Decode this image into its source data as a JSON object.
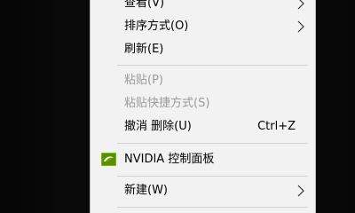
{
  "menu": {
    "items": [
      {
        "label": "查看(V)",
        "has_submenu": true,
        "disabled": false
      },
      {
        "label": "排序方式(O)",
        "has_submenu": true,
        "disabled": false
      },
      {
        "label": "刷新(E)",
        "has_submenu": false,
        "disabled": false
      },
      {
        "label": "粘贴(P)",
        "has_submenu": false,
        "disabled": true
      },
      {
        "label": "粘贴快捷方式(S)",
        "has_submenu": false,
        "disabled": true
      },
      {
        "label": "撤消 删除(U)",
        "shortcut": "Ctrl+Z",
        "has_submenu": false,
        "disabled": false
      },
      {
        "label": "NVIDIA 控制面板",
        "icon": "nvidia-icon",
        "has_submenu": false,
        "disabled": false
      },
      {
        "label": "新建(W)",
        "has_submenu": true,
        "disabled": false
      }
    ]
  },
  "colors": {
    "menu_background": "#f2f2f2",
    "disabled_text": "#9a9a9a",
    "nvidia_green": "#76b900",
    "desktop_background": "#000000"
  }
}
